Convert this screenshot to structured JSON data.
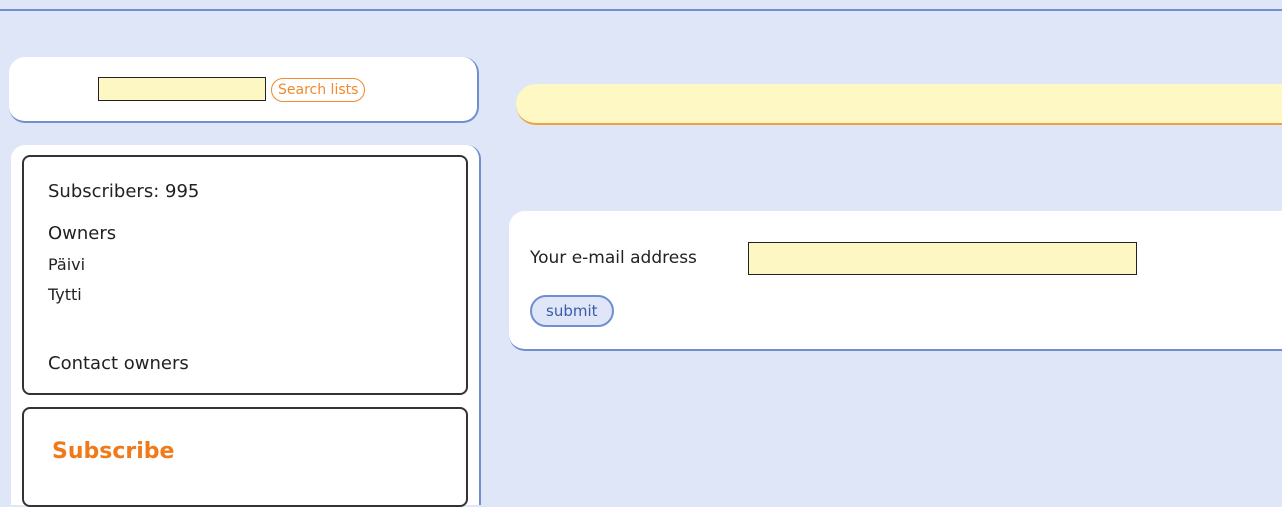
{
  "search": {
    "input_value": "",
    "button_label": "Search lists"
  },
  "sidebar": {
    "subscribers_text": "Subscribers: 995",
    "owners_heading": "Owners",
    "owners": [
      "Päivi",
      "Tytti"
    ],
    "contact_owners": "Contact owners",
    "subscribe_title": "Subscribe"
  },
  "form": {
    "email_label": "Your e-mail address",
    "email_value": "",
    "submit_label": "submit"
  },
  "colors": {
    "page_bg": "#dfe6f7",
    "accent_blue": "#6f8fd0",
    "accent_orange": "#f08a2c",
    "input_yellow": "#fdf7c4"
  }
}
